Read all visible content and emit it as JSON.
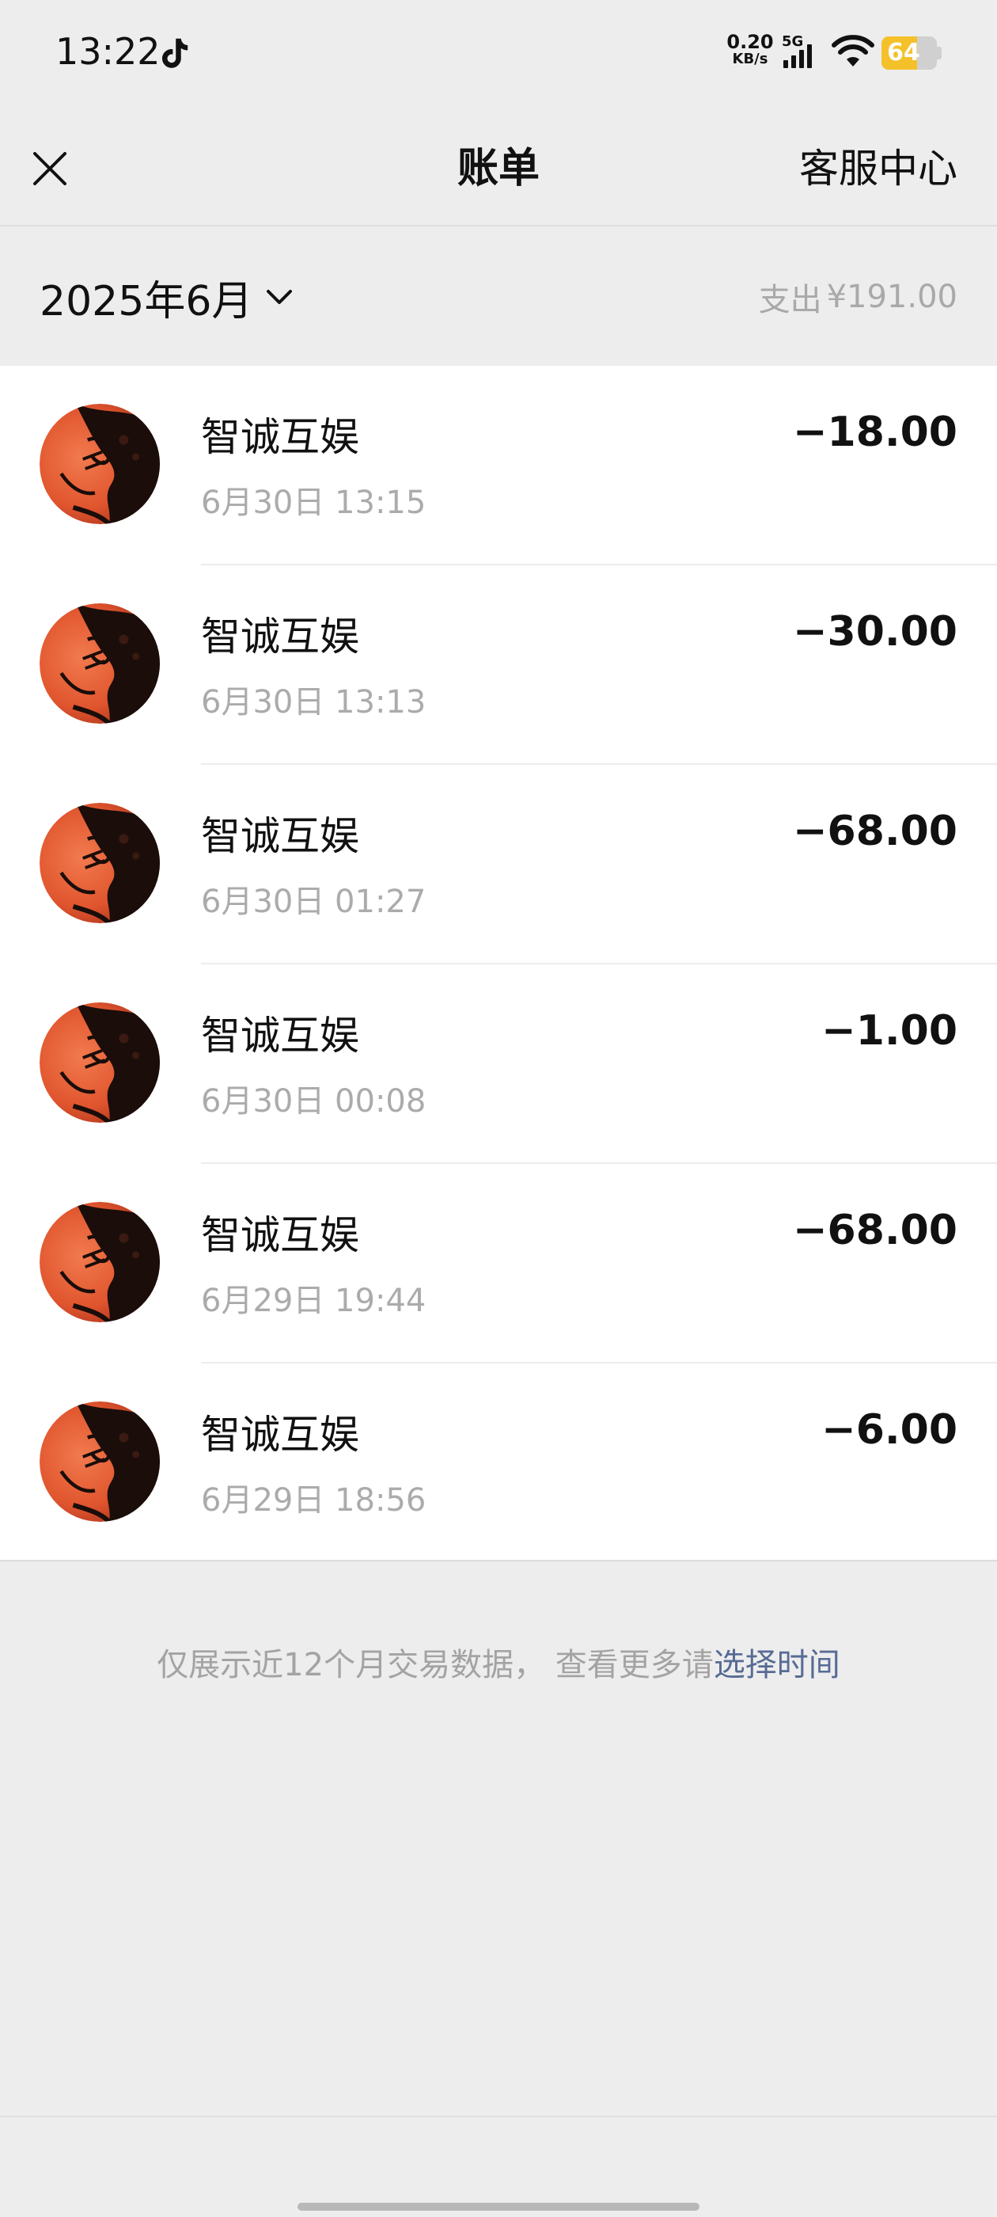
{
  "status_bar": {
    "time": "13:22",
    "net_speed_value": "0.20",
    "net_speed_unit": "KB/s",
    "network_type": "5G",
    "battery_level": "64",
    "battery_fraction": 0.64,
    "icons": [
      "tiktok-icon",
      "signal-icon",
      "wifi-icon",
      "battery-icon"
    ]
  },
  "nav": {
    "title": "账单",
    "close_icon": "close-icon",
    "service_label": "客服中心"
  },
  "month_header": {
    "month_label": "2025年6月",
    "expense_label": "支出",
    "expense_amount": "¥191.00"
  },
  "transactions": [
    {
      "merchant": "智诚互娱",
      "time": "6月30日 13:15",
      "amount": "−18.00"
    },
    {
      "merchant": "智诚互娱",
      "time": "6月30日 13:13",
      "amount": "−30.00"
    },
    {
      "merchant": "智诚互娱",
      "time": "6月30日 01:27",
      "amount": "−68.00"
    },
    {
      "merchant": "智诚互娱",
      "time": "6月30日 00:08",
      "amount": "−1.00"
    },
    {
      "merchant": "智诚互娱",
      "time": "6月29日 19:44",
      "amount": "−68.00"
    },
    {
      "merchant": "智诚互娱",
      "time": "6月29日 18:56",
      "amount": "−6.00"
    }
  ],
  "footer": {
    "note_text": "仅展示近12个月交易数据， 查看更多请",
    "link_text": "选择时间"
  },
  "colors": {
    "background": "#ededed",
    "surface": "#ffffff",
    "link": "#576b95",
    "muted_text": "#ababab",
    "battery_accent": "#f5c12b",
    "avatar_red": "#e0552e"
  }
}
